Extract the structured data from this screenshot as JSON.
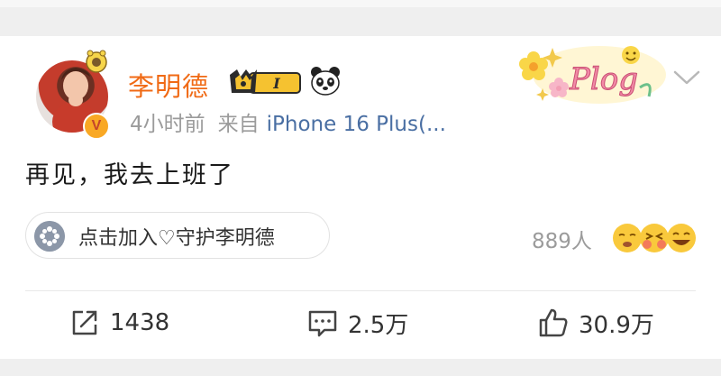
{
  "post": {
    "username": "李明德",
    "vip_level": "I",
    "time_ago": "4小时前",
    "source_prefix": "来自",
    "device": "iPhone 16 Plus(...",
    "content": "再见，我去上班了",
    "tag_label": "Plog",
    "verified_mark": "V"
  },
  "fan_club": {
    "label": "点击加入♡守护李明德",
    "count": "889人"
  },
  "actions": {
    "reposts": "1438",
    "comments": "2.5万",
    "likes": "30.9万"
  },
  "colors": {
    "username": "#f06a15",
    "device_link": "#4a6fa3",
    "meta": "#9b9b9b",
    "verified_badge": "#f9a824"
  }
}
